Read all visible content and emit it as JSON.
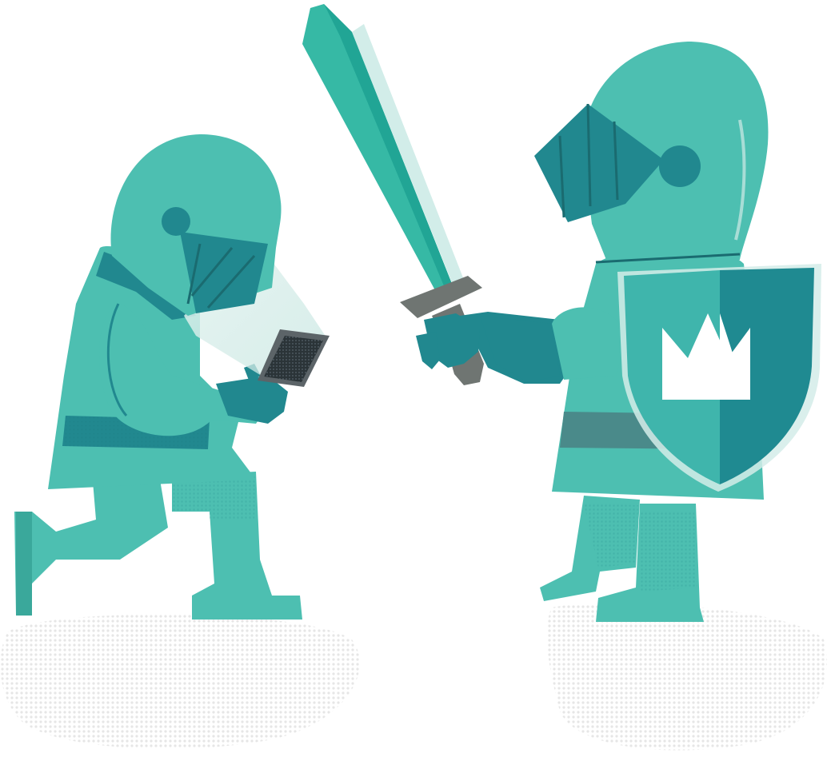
{
  "illustration": {
    "subject": "two-knights",
    "colors": {
      "armor": "#4dbfb1",
      "armor_dark": "#21888f",
      "armor_shadow": "#1d6f74",
      "sword_blade": "#36b9a5",
      "sword_hilt": "#6f7572",
      "shield_light": "#3fb5ac",
      "shield_dark": "#1f8a91",
      "emblem": "#ffffff",
      "ground_dots": "#e4e4e4",
      "phone_screen": "#2b3438",
      "phone_glow": "#d8eeea"
    },
    "icons": {
      "shield_emblem": "crown-icon",
      "device": "smartphone-icon",
      "weapon": "sword-icon"
    }
  }
}
